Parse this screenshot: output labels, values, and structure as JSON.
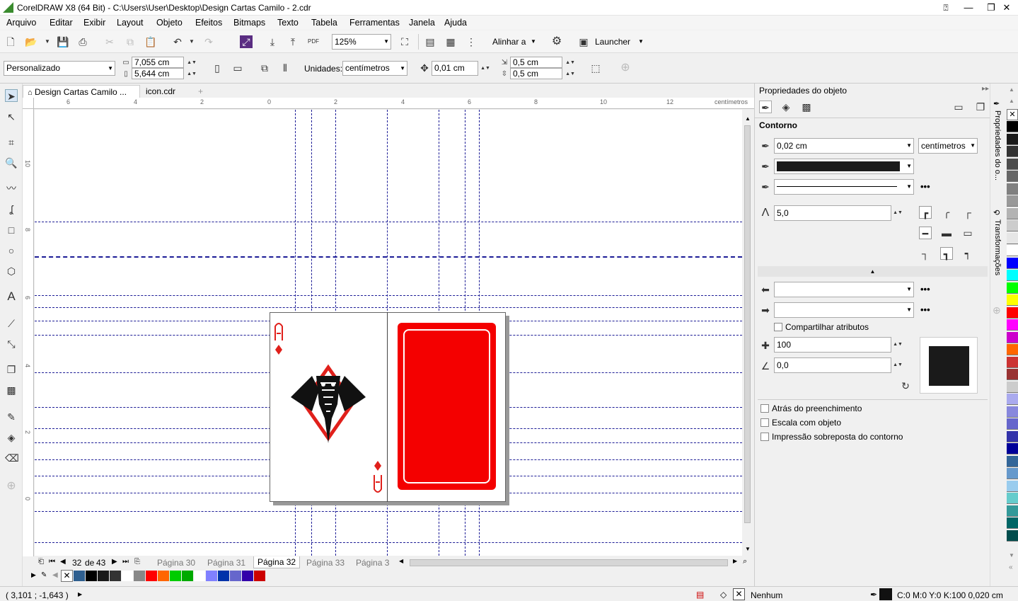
{
  "window": {
    "title": "CorelDRAW X8 (64 Bit) - C:\\Users\\User\\Desktop\\Design Cartas Camilo - 2.cdr",
    "minimize": "—",
    "restore": "❐",
    "close": "✕"
  },
  "menu": [
    "Arquivo",
    "Editar",
    "Exibir",
    "Layout",
    "Objeto",
    "Efeitos",
    "Bitmaps",
    "Texto",
    "Tabela",
    "Ferramentas",
    "Janela",
    "Ajuda"
  ],
  "toolbar": {
    "zoom": "125%",
    "align_label": "Alinhar a",
    "launcher_label": "Launcher"
  },
  "propbar": {
    "preset": "Personalizado",
    "width": "7,055 cm",
    "height": "5,644 cm",
    "units_label": "Unidades:",
    "units": "centímetros",
    "nudge": "0,01 cm",
    "dup_x": "0,5 cm",
    "dup_y": "0,5 cm"
  },
  "doctabs": [
    {
      "label": "Design Cartas Camilo ...",
      "active": true
    },
    {
      "label": "icon.cdr",
      "active": false
    }
  ],
  "ruler": {
    "h_labels": [
      "6",
      "4",
      "2",
      "0",
      "2",
      "4",
      "6",
      "8",
      "10",
      "12"
    ],
    "v_labels": [
      "10",
      "8",
      "6",
      "4",
      "2",
      "0"
    ],
    "unit": "centímetros"
  },
  "pages": {
    "counter_current": "32",
    "counter_of": "de",
    "counter_total": "43",
    "tabs": [
      "Página 30",
      "Página 31",
      "Página 32",
      "Página 33",
      "Página 3"
    ],
    "active": "Página 32"
  },
  "status": {
    "coords": "( 3,101 ; -1,643 )",
    "fill": "Nenhum",
    "outline": "C:0 M:0 Y:0 K:100  0,020 cm"
  },
  "props": {
    "title": "Propriedades do objeto",
    "section": "Contorno",
    "width": "0,02 cm",
    "units": "centímetros",
    "miter": "5,0",
    "share_attrs": "Compartilhar atributos",
    "stretch": "100",
    "angle": "0,0",
    "behind_fill": "Atrás do preenchimento",
    "scale_with_obj": "Escala com objeto",
    "overprint": "Impressão sobreposta do contorno",
    "contour_color": "#1a1a1a"
  },
  "sidetabs": [
    "Propriedades do o...",
    "Transformações"
  ],
  "colors": {
    "card_red": "#f40000",
    "guide": "#1c1c96"
  },
  "palette_bottom": [
    "#2f5f8f",
    "#000000",
    "#1a1a1a",
    "#333333",
    "#ffffff",
    "#888888",
    "#ff0000",
    "#ff6600",
    "#00cc00",
    "#00aa00",
    "#ffffff",
    "#8080ff",
    "#0033aa",
    "#6666cc",
    "#3300aa",
    "#cc0000"
  ],
  "palette_right": [
    "#000000",
    "#1a1a1a",
    "#333333",
    "#4d4d4d",
    "#666666",
    "#808080",
    "#999999",
    "#b3b3b3",
    "#cccccc",
    "#e6e6e6",
    "#ffffff",
    "#0000ff",
    "#00ffff",
    "#00ff00",
    "#ffff00",
    "#ff0000",
    "#ff00ff",
    "#cc00cc",
    "#ff6600",
    "#cc3333",
    "#993333",
    "#cccccc",
    "#aaaaee",
    "#8888dd",
    "#6666cc",
    "#3333aa",
    "#000099",
    "#336699",
    "#6699cc",
    "#99ccee",
    "#66cccc",
    "#339999",
    "#006666",
    "#004d4d"
  ]
}
